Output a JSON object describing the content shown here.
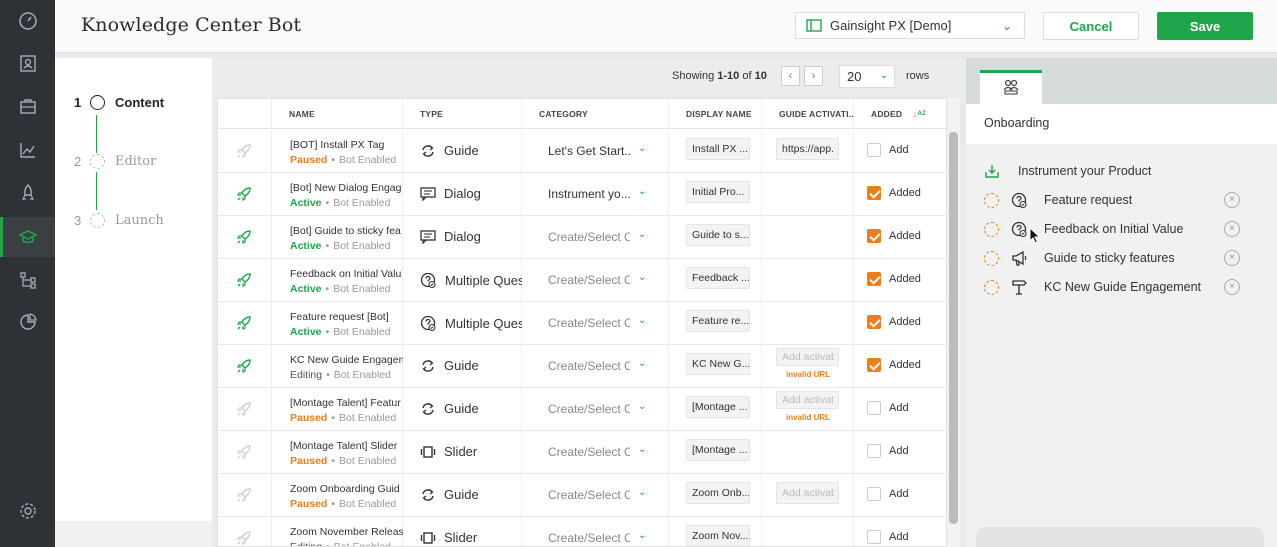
{
  "header": {
    "title": "Knowledge Center Bot",
    "app_select": "Gainsight PX [Demo]",
    "cancel_label": "Cancel",
    "save_label": "Save"
  },
  "nav_rail": {
    "items": [
      "dashboard-icon",
      "people-icon",
      "briefcase-icon",
      "analytics-icon",
      "rocket-icon",
      "knowledge-center-icon",
      "journey-icon",
      "reports-icon"
    ],
    "active": "knowledge-center-icon",
    "bottom": "settings-icon"
  },
  "steps": [
    {
      "num": "1",
      "label": "Content",
      "active": true
    },
    {
      "num": "2",
      "label": "Editor",
      "active": false
    },
    {
      "num": "3",
      "label": "Launch",
      "active": false
    }
  ],
  "pagination": {
    "showing_prefix": "Showing ",
    "range": "1-10",
    "of_text": " of ",
    "total": "10",
    "rows_value": "20",
    "rows_label": "rows"
  },
  "table": {
    "columns": [
      "NAME",
      "TYPE",
      "CATEGORY",
      "DISPLAY NAME",
      "GUIDE ACTIVATI...",
      "ADDED"
    ],
    "rows": [
      {
        "name": "[BOT] Install PX Tag",
        "status": "Paused",
        "bot": "Bot Enabled",
        "type": "Guide",
        "type_icon": "guide-icon",
        "category": "Let's Get Start...",
        "category_real": true,
        "display_name": "Install PX ...",
        "activation": "https://app.",
        "activation_real": true,
        "invalid": "",
        "added": false,
        "added_label": "Add",
        "rocket_active": false
      },
      {
        "name": "[Bot] New Dialog Engag",
        "status": "Active",
        "bot": "Bot Enabled",
        "type": "Dialog",
        "type_icon": "dialog-icon",
        "category": "Instrument yo...",
        "category_real": true,
        "display_name": "Initial Pro...",
        "activation": "",
        "activation_real": false,
        "invalid": "",
        "added": true,
        "added_label": "Added",
        "rocket_active": true
      },
      {
        "name": "[Bot] Guide to sticky fea",
        "status": "Active",
        "bot": "Bot Enabled",
        "type": "Dialog",
        "type_icon": "dialog-icon",
        "category": "Create/Select Ca",
        "category_real": false,
        "display_name": "Guide to s...",
        "activation": "",
        "activation_real": false,
        "invalid": "",
        "added": true,
        "added_label": "Added",
        "rocket_active": true
      },
      {
        "name": "Feedback on Initial Valu",
        "status": "Active",
        "bot": "Bot Enabled",
        "type": "Multiple Quest",
        "type_icon": "survey-icon",
        "category": "Create/Select Ca",
        "category_real": false,
        "display_name": "Feedback ...",
        "activation": "",
        "activation_real": false,
        "invalid": "",
        "added": true,
        "added_label": "Added",
        "rocket_active": true
      },
      {
        "name": "Feature request [Bot]",
        "status": "Active",
        "bot": "Bot Enabled",
        "type": "Multiple Quest",
        "type_icon": "survey-icon",
        "category": "Create/Select Ca",
        "category_real": false,
        "display_name": "Feature re...",
        "activation": "",
        "activation_real": false,
        "invalid": "",
        "added": true,
        "added_label": "Added",
        "rocket_active": true
      },
      {
        "name": "KC New Guide Engagen",
        "status": "Editing",
        "bot": "Bot Enabled",
        "type": "Guide",
        "type_icon": "guide-icon",
        "category": "Create/Select Ca",
        "category_real": false,
        "display_name": "KC New G...",
        "activation": "Add activat",
        "activation_real": false,
        "invalid": "invalid URL",
        "added": true,
        "added_label": "Added",
        "rocket_active": true
      },
      {
        "name": "[Montage Talent] Featur",
        "status": "Paused",
        "bot": "Bot Enabled",
        "type": "Guide",
        "type_icon": "guide-icon",
        "category": "Create/Select Ca",
        "category_real": false,
        "display_name": "[Montage ...",
        "activation": "Add activat",
        "activation_real": false,
        "invalid": "invalid URL",
        "added": false,
        "added_label": "Add",
        "rocket_active": false
      },
      {
        "name": "[Montage Talent] Slider",
        "status": "Paused",
        "bot": "Bot Enabled",
        "type": "Slider",
        "type_icon": "slider-icon",
        "category": "Create/Select Ca",
        "category_real": false,
        "display_name": "[Montage ...",
        "activation": "",
        "activation_real": false,
        "invalid": "",
        "added": false,
        "added_label": "Add",
        "rocket_active": false
      },
      {
        "name": "Zoom Onboarding Guid",
        "status": "Paused",
        "bot": "Bot Enabled",
        "type": "Guide",
        "type_icon": "guide-icon",
        "category": "Create/Select Ca",
        "category_real": false,
        "display_name": "Zoom Onb...",
        "activation": "Add activat",
        "activation_real": false,
        "invalid": "",
        "added": false,
        "added_label": "Add",
        "rocket_active": false
      },
      {
        "name": "Zoom November Releas",
        "status": "Editing",
        "bot": "Bot Enabled",
        "type": "Slider",
        "type_icon": "slider-icon",
        "category": "Create/Select Ca",
        "category_real": false,
        "display_name": "Zoom Nov...",
        "activation": "",
        "activation_real": false,
        "invalid": "",
        "added": false,
        "added_label": "Add",
        "rocket_active": false
      }
    ]
  },
  "right_panel": {
    "tab_icon": "onboarding-people-icon",
    "title": "Onboarding",
    "folder": {
      "label": "Instrument your Product",
      "icon": "download-tray-icon"
    },
    "items": [
      {
        "label": "Feature request",
        "icon": "survey-icon"
      },
      {
        "label": "Feedback on Initial Value",
        "icon": "survey-icon"
      },
      {
        "label": "Guide to sticky features",
        "icon": "megaphone-icon"
      },
      {
        "label": "KC New Guide Engagement",
        "icon": "signpost-icon"
      }
    ]
  },
  "colors": {
    "green": "#1fa64a",
    "orange": "#ef7d1a",
    "rail": "#2e3236"
  }
}
